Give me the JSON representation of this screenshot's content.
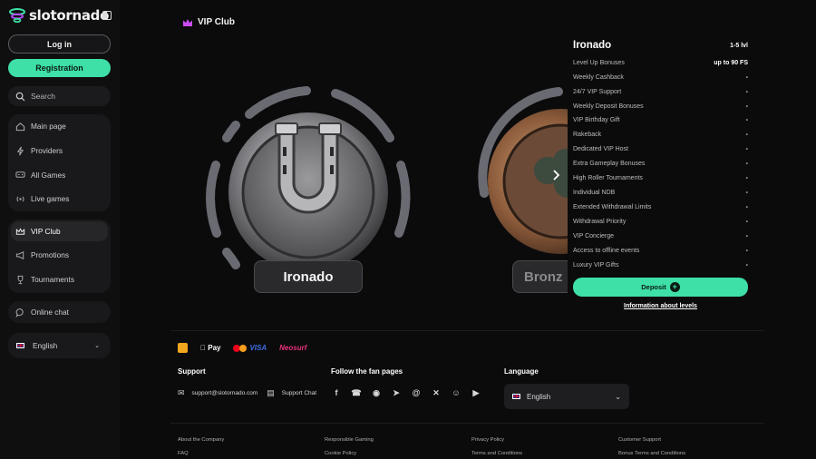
{
  "brand": {
    "name": "slotornado"
  },
  "sidebar": {
    "login_label": "Log in",
    "registration_label": "Registration",
    "search_placeholder": "Search",
    "main_nav": [
      {
        "label": "Main page",
        "icon": "home-icon"
      },
      {
        "label": "Providers",
        "icon": "lightning-icon"
      },
      {
        "label": "All Games",
        "icon": "gamepad-icon"
      },
      {
        "label": "Live games",
        "icon": "live-icon"
      }
    ],
    "promo_nav": [
      {
        "label": "VIP Club",
        "icon": "crown-icon",
        "active": true
      },
      {
        "label": "Promotions",
        "icon": "megaphone-icon"
      },
      {
        "label": "Tournaments",
        "icon": "trophy-icon"
      }
    ],
    "online_chat_label": "Online chat",
    "language_label": "English"
  },
  "main": {
    "section_title": "VIP Club",
    "levels": [
      {
        "name": "Ironado"
      },
      {
        "name": "Bronz"
      }
    ]
  },
  "level_panel": {
    "title": "Ironado",
    "range": "1-5 lvl",
    "perks": [
      {
        "label": "Level Up Bonuses",
        "value": "up to 90 FS"
      },
      {
        "label": "Weekly Cashback",
        "value": "-"
      },
      {
        "label": "24/7 VIP Support",
        "value": "-"
      },
      {
        "label": "Weekly Deposit Bonuses",
        "value": "-"
      },
      {
        "label": "VIP Birthday Gift",
        "value": "-"
      },
      {
        "label": "Rakeback",
        "value": "-"
      },
      {
        "label": "Dedicated VIP Host",
        "value": "-"
      },
      {
        "label": "Extra Gameplay Bonuses",
        "value": "-"
      },
      {
        "label": "High Roller Tournaments",
        "value": "-"
      },
      {
        "label": "Individual NDB",
        "value": "-"
      },
      {
        "label": "Extended Withdrawal Limits",
        "value": "-"
      },
      {
        "label": "Withdrawal Priority",
        "value": "-"
      },
      {
        "label": "VIP Concierge",
        "value": "-"
      },
      {
        "label": "Access to offline events",
        "value": "-"
      },
      {
        "label": "Luxury VIP Gifts",
        "value": "-"
      }
    ],
    "deposit_label": "Deposit",
    "info_link": "Information about levels"
  },
  "footer": {
    "payments": {
      "apple_pay": "Pay",
      "visa": "VISA",
      "neosurf": "Neosurf"
    },
    "support_title": "Support",
    "support_email": "support@slotornado.com",
    "support_chat": "Support Chat",
    "fanpages_title": "Follow the fan pages",
    "social_icons": [
      "facebook-icon",
      "whatsapp-icon",
      "instagram-icon",
      "telegram-icon",
      "threads-icon",
      "x-icon",
      "reddit-icon",
      "youtube-icon"
    ],
    "language_title": "Language",
    "language_value": "English",
    "links": [
      [
        "About the Company",
        "FAQ"
      ],
      [
        "Responsible Gaming",
        "Cookie Policy"
      ],
      [
        "Privacy Policy",
        "Terms and Conditions"
      ],
      [
        "Customer Support",
        "Bonus Terms and Conditions"
      ]
    ]
  },
  "colors": {
    "accent": "#3ee0a8",
    "crown": "#c84cf0",
    "background": "#0b0b0c"
  }
}
